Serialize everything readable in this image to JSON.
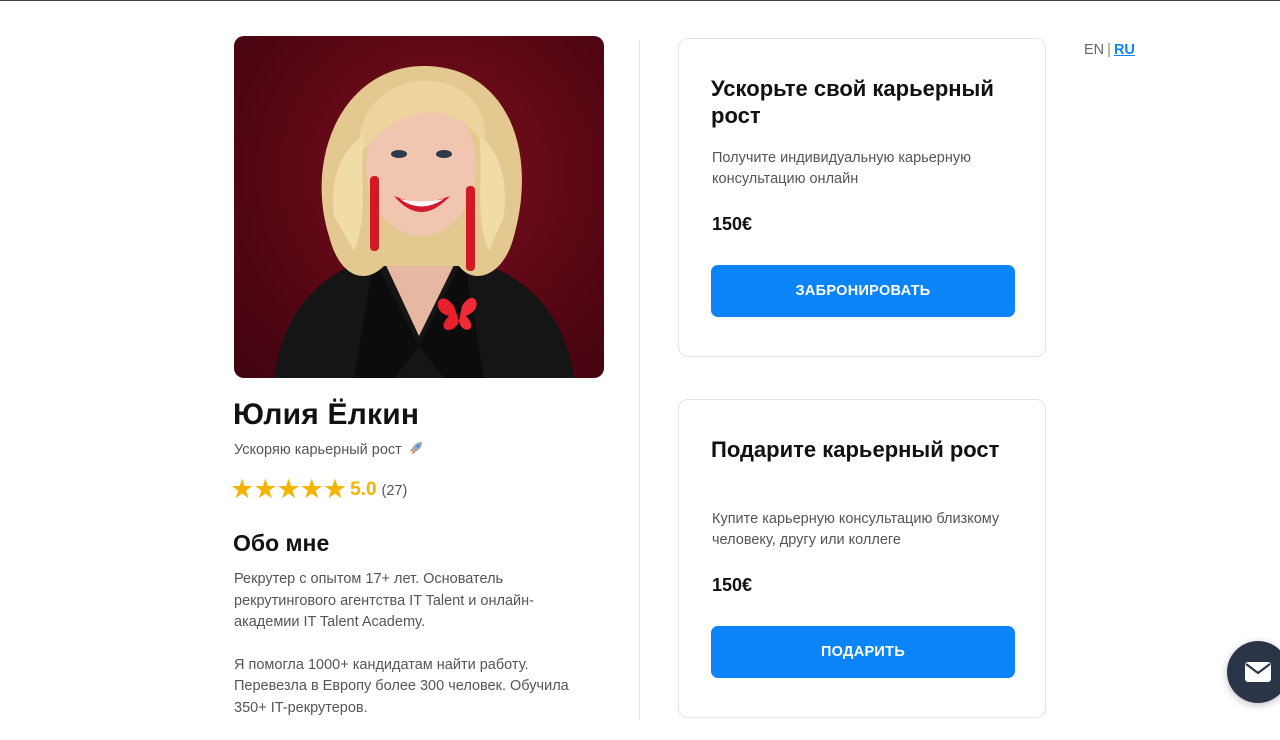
{
  "profile": {
    "name": "Юлия Ёлкин",
    "tagline": "Ускоряю карьерный рост",
    "rating": {
      "stars": 5,
      "value": "5.0",
      "count": "(27)"
    },
    "about_title": "Обо мне",
    "about_paragraphs": [
      "Рекрутер с опытом 17+ лет. Основатель рекрутингового агентства IT Talent и онлайн-академии IT Talent Academy.",
      "Я помогла 1000+ кандидатам найти работу. Перевезла в Европу более 300 человек. Обучила 350+ IT-рекрутеров."
    ]
  },
  "cards": [
    {
      "title": "Ускорьте свой карьерный рост",
      "description": "Получите индивидуальную карьерную консультацию онлайн",
      "price": "150€",
      "button": "ЗАБРОНИРОВАТЬ"
    },
    {
      "title": "Подарите карьерный рост",
      "description": "Купите карьерную консультацию близкому человеку, другу или коллеге",
      "price": "150€",
      "button": "ПОДАРИТЬ"
    }
  ],
  "language": {
    "options": [
      "EN",
      "RU"
    ],
    "separator": "|",
    "active": "RU"
  },
  "icons": {
    "rocket": "rocket-icon",
    "star": "star-icon",
    "chat": "mail-icon"
  },
  "colors": {
    "accent": "#0a84f6",
    "star": "#f5b400",
    "chat_bubble": "#2a3547",
    "photo_background": "#5a0714"
  }
}
